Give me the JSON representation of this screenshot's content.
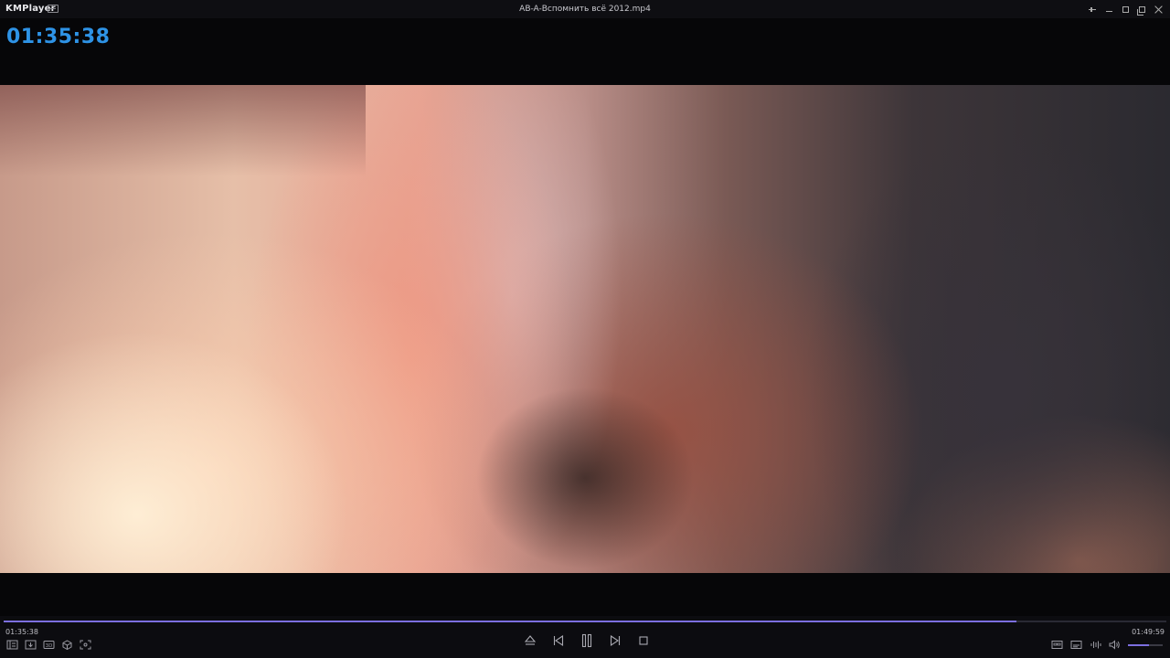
{
  "app": {
    "name": "KMPlayer"
  },
  "window": {
    "title": "AB-A-Вспомнить всё 2012.mp4"
  },
  "osd": {
    "time": "01:35:38"
  },
  "playback": {
    "current_time": "01:35:38",
    "total_time": "01:49:59",
    "progress_fraction": 0.871,
    "volume_fraction": 0.6
  },
  "icons": {
    "window": [
      "pin-icon",
      "minimize-icon",
      "maximize-icon",
      "fullscreen-icon",
      "close-icon"
    ],
    "left_tools": [
      "playlist-icon",
      "download-icon",
      "3d-icon",
      "vr-icon",
      "capture-icon"
    ],
    "center": [
      "eject-icon",
      "previous-icon",
      "pause-icon",
      "next-icon",
      "stop-icon"
    ],
    "right": [
      "subtitle-icon",
      "caption-icon",
      "equalizer-icon",
      "speaker-icon"
    ]
  },
  "colors": {
    "accent": "#7c6fe0",
    "osd_time": "#2e93e6",
    "background": "#060608"
  }
}
